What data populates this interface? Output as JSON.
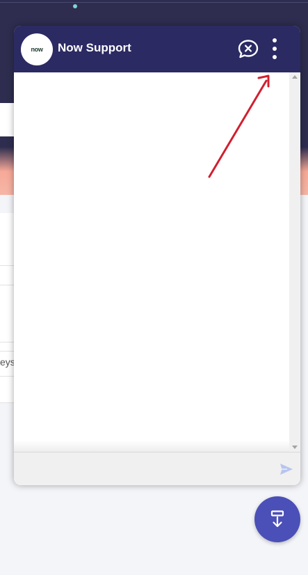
{
  "chat": {
    "title": "Now Support",
    "logo_text": "now",
    "composer": {
      "value": "",
      "placeholder": ""
    }
  },
  "background": {
    "partial_text": "eys"
  },
  "icons": {
    "end_chat": "chat-close-icon",
    "more": "vertical-dots-icon",
    "send": "send-icon",
    "fab": "minimize-chat-icon"
  },
  "colors": {
    "header": "#2b2a63",
    "fab": "#4b4fb8",
    "annotation": "#d11f2f",
    "send": "#b7c4f0"
  }
}
